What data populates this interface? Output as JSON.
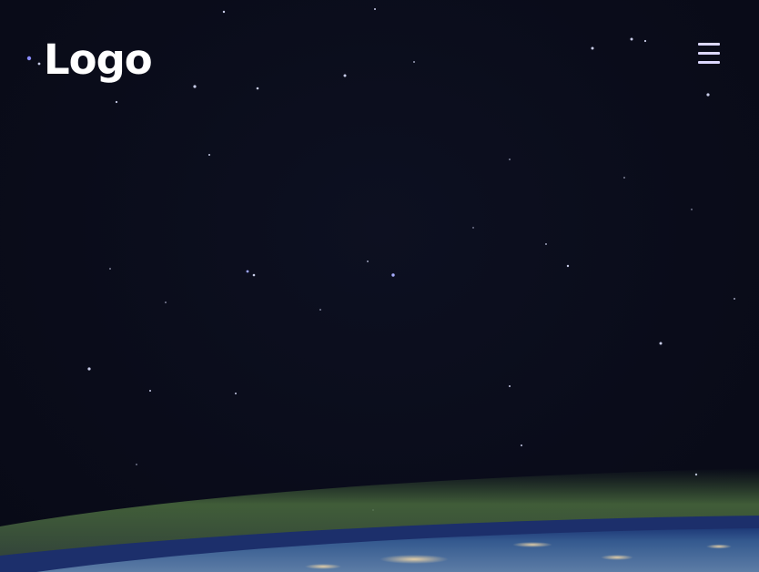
{
  "header": {
    "logo_text": "Logo",
    "menu_icon": "hamburger-menu-icon"
  },
  "colors": {
    "background": "#0b0d1c",
    "logo_text": "#ffffff",
    "menu_icon": "#dcd8ff",
    "earth_atmosphere": "#4a6b3e",
    "earth_ocean": "#2d4a78"
  }
}
